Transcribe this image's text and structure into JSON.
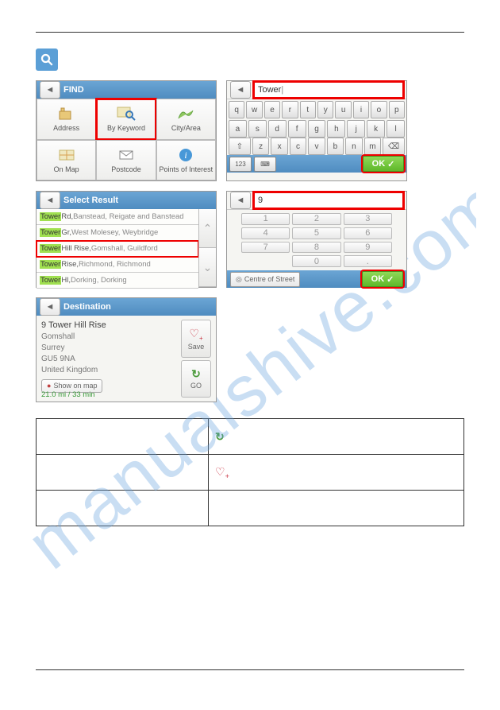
{
  "watermark": "manualshive.com",
  "screens": {
    "find": {
      "title": "FIND",
      "cells": [
        "Address",
        "By Keyword",
        "City/Area",
        "On Map",
        "Postcode",
        "Points of Interest"
      ]
    },
    "keyboard": {
      "input": "Tower",
      "row1": [
        "q",
        "w",
        "e",
        "r",
        "t",
        "y",
        "u",
        "i",
        "o",
        "p"
      ],
      "row2": [
        "a",
        "s",
        "d",
        "f",
        "g",
        "h",
        "j",
        "k",
        "l"
      ],
      "row3": [
        "⇧",
        "z",
        "x",
        "c",
        "v",
        "b",
        "n",
        "m",
        "⌫"
      ],
      "btn123": "123",
      "ok": "OK"
    },
    "select": {
      "title": "Select Result",
      "rows": [
        {
          "hl": "Tower",
          "dark": " Rd,",
          "rest": " Banstead, Reigate and Banstead"
        },
        {
          "hl": "Tower",
          "dark": " Gr,",
          "rest": " West Molesey, Weybridge"
        },
        {
          "hl": "Tower",
          "dark": " Hill Rise,",
          "rest": " Gomshall, Guildford"
        },
        {
          "hl": "Tower",
          "dark": " Rise,",
          "rest": " Richmond, Richmond"
        },
        {
          "hl": "Tower",
          "dark": " Hl,",
          "rest": " Dorking, Dorking"
        }
      ]
    },
    "numpad": {
      "input": "9",
      "keys": [
        "1",
        "2",
        "3",
        "4",
        "5",
        "6",
        "7",
        "8",
        "9",
        "",
        "0",
        "."
      ],
      "centre": "Centre of Street",
      "ok": "OK"
    },
    "dest": {
      "title": "Destination",
      "line1": "9 Tower Hill Rise",
      "line2": "Gomshall",
      "line3": "Surrey",
      "line4": "GU5 9NA",
      "line5": "United Kingdom",
      "showmap": "Show on map",
      "dist": "21.0 mi / 33 min",
      "save": "Save",
      "go": "GO"
    }
  }
}
